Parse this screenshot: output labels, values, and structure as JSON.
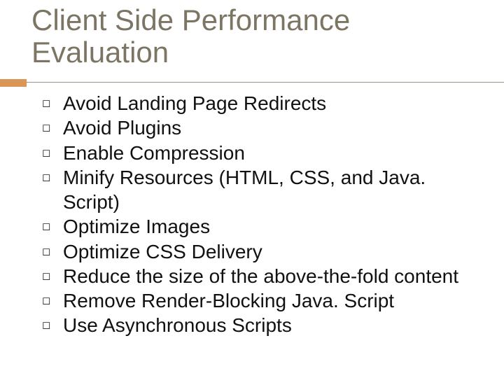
{
  "title": "Client Side Performance Evaluation",
  "items": [
    "Avoid Landing Page Redirects",
    "Avoid Plugins",
    "Enable Compression",
    "Minify Resources (HTML, CSS, and Java. Script)",
    "Optimize Images",
    "Optimize CSS Delivery",
    "Reduce the size of the above-the-fold content",
    "Remove Render-Blocking Java. Script",
    "Use Asynchronous Scripts"
  ],
  "bullet_glyph": "◻"
}
